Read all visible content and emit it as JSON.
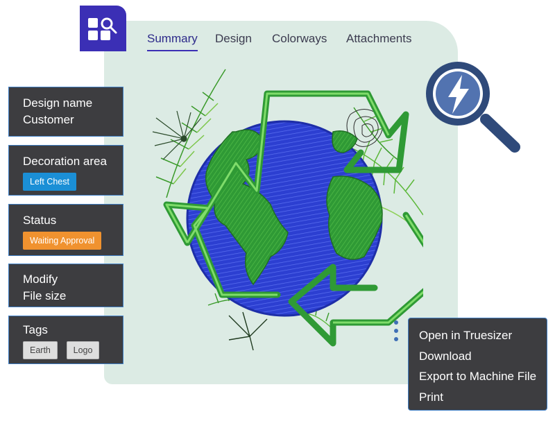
{
  "tabs": [
    {
      "label": "Summary",
      "active": true
    },
    {
      "label": "Design",
      "active": false
    },
    {
      "label": "Colorways",
      "active": false
    },
    {
      "label": "Attachments",
      "active": false
    }
  ],
  "cards": {
    "design": {
      "line1": "Design name",
      "line2": "Customer"
    },
    "decoration": {
      "title": "Decoration area",
      "badge": "Left Chest"
    },
    "status": {
      "title": "Status",
      "badge": "Waiting Approval"
    },
    "modify": {
      "line1": "Modify",
      "line2": "File size"
    },
    "tags": {
      "title": "Tags",
      "items": [
        "Earth",
        "Logo"
      ]
    }
  },
  "menu": {
    "items": [
      "Open in Truesizer",
      "Download",
      "Export to Machine File",
      "Print"
    ]
  },
  "colors": {
    "brand": "#3b2fb5",
    "card_bg": "#3d3d40",
    "card_border": "#3f7fc6",
    "badge_blue": "#1b8fd6",
    "badge_orange": "#f0922f",
    "panel_bg": "#dcebe4",
    "magnifier": "#2f4a7a"
  },
  "icons": {
    "app": "design-search-icon",
    "magnifier": "lightning-magnifier-icon",
    "more": "kebab-menu-icon",
    "artwork": "embroidered-recycle-globe"
  }
}
